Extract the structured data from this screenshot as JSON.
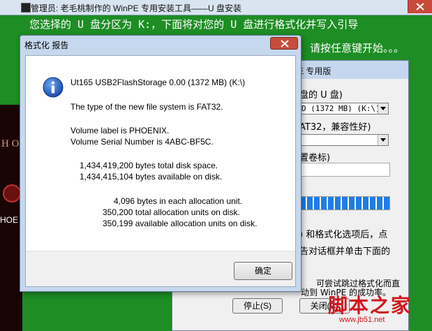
{
  "console": {
    "title": "管理员: 老毛桃制作的 WinPE 专用安装工具——U 盘安装",
    "line1": "您选择的 U 盘分区为 K:，下面将对您的 U 盘进行格式化并写入引导",
    "line2": "请按任意键开始。。。",
    "left_fragment": "H O",
    "left_hoe": "HOE"
  },
  "installer": {
    "title": "E 专用版",
    "select_disk_label": "盘的 U 盘)",
    "disk_value": "D (1372 MB) (K:\\)",
    "fs_label": "AT32，兼容性好)",
    "volume_label": "置卷标)",
    "progress_pct": 100,
    "hint1": ") 和格式化选项后，点",
    "hint2": "告对话框并单击下面的",
    "hint3": "可尝试跳过格式化而直",
    "hint4": "动到 WinPE 的成功率。",
    "stop_button": "停止(S)",
    "close_button": "关闭(C)"
  },
  "report": {
    "title": "格式化 报告",
    "device": "Ut165 USB2FlashStorage 0.00 (1372 MB) (K:\\)",
    "fs_line": "The type of the new file system is FAT32.",
    "vol_label": "Volume label is PHOENIX.",
    "serial": "Volume Serial Number is 4ABC-BF5C.",
    "total_space": "1,434,419,200 bytes total disk space.",
    "avail_space": "1,434,415,104 bytes available on disk.",
    "alloc_unit": "4,096 bytes in each allocation unit.",
    "total_units": "350,200 total allocation units on disk.",
    "avail_units": "350,199 available allocation units on disk.",
    "ok_button": "确定"
  },
  "watermark": {
    "text": "脚本之家",
    "url": "www.jb51.net"
  },
  "colors": {
    "console_bg": "#1d8d24",
    "accent_blue": "#1d7de8",
    "watermark": "#d2161d"
  }
}
